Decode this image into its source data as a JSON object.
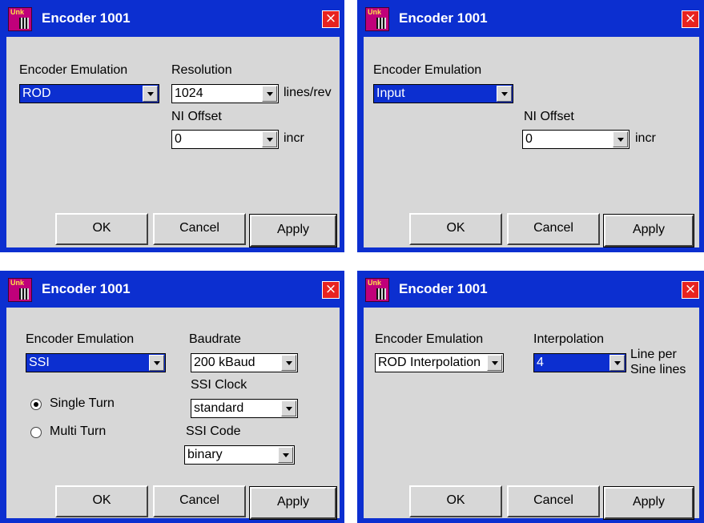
{
  "dialogs": [
    {
      "title": "Encoder 1001",
      "close": "×",
      "emulation_label": "Encoder Emulation",
      "emulation_value": "ROD",
      "resolution_label": "Resolution",
      "resolution_value": "1024",
      "resolution_unit": "lines/rev",
      "ni_offset_label": "NI Offset",
      "ni_offset_value": "0",
      "ni_offset_unit": "incr",
      "ok": "OK",
      "cancel": "Cancel",
      "apply": "Apply"
    },
    {
      "title": "Encoder 1001",
      "close": "×",
      "emulation_label": "Encoder Emulation",
      "emulation_value": "Input",
      "ni_offset_label": "NI Offset",
      "ni_offset_value": "0",
      "ni_offset_unit": "incr",
      "ok": "OK",
      "cancel": "Cancel",
      "apply": "Apply"
    },
    {
      "title": "Encoder 1001",
      "close": "×",
      "emulation_label": "Encoder Emulation",
      "emulation_value": "SSI",
      "baudrate_label": "Baudrate",
      "baudrate_value": "200 kBaud",
      "ssi_clock_label": "SSI Clock",
      "ssi_clock_value": "standard",
      "ssi_code_label": "SSI Code",
      "ssi_code_value": "binary",
      "single_turn_label": "Single Turn",
      "multi_turn_label": "Multi Turn",
      "turn_selected": "Single Turn",
      "ok": "OK",
      "cancel": "Cancel",
      "apply": "Apply"
    },
    {
      "title": "Encoder 1001",
      "close": "×",
      "emulation_label": "Encoder Emulation",
      "emulation_value": "ROD Interpolation",
      "interpolation_label": "Interpolation",
      "interpolation_value": "4",
      "interpolation_unit_line1": "Line per",
      "interpolation_unit_line2": "Sine lines",
      "ok": "OK",
      "cancel": "Cancel",
      "apply": "Apply"
    }
  ],
  "colors": {
    "title_bar": "#0c2fd0",
    "client_bg": "#d7d7d7",
    "close_button": "#e8231f",
    "selection": "#0c2fd0"
  },
  "icons": {
    "app": "unk-app-icon",
    "close": "close-icon",
    "dropdown": "chevron-down-icon"
  }
}
